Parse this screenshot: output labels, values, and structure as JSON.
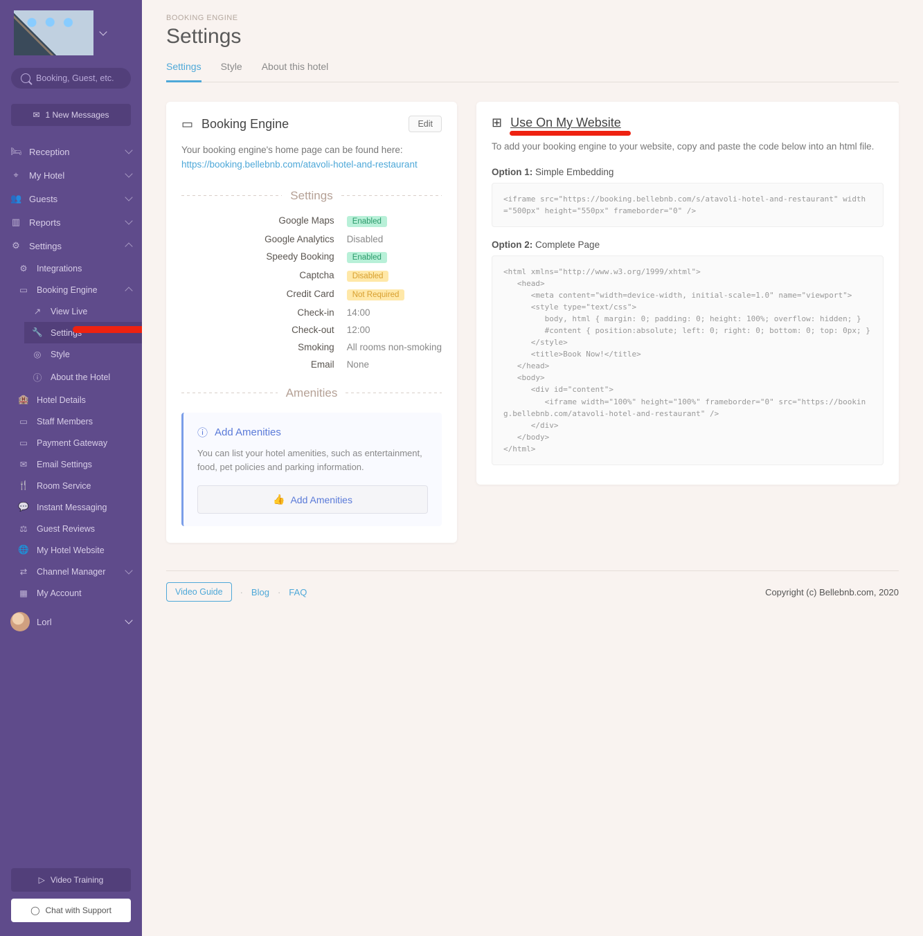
{
  "search": {
    "placeholder": "Booking, Guest, etc."
  },
  "messages_btn": "1 New Messages",
  "nav": {
    "reception": "Reception",
    "myhotel": "My Hotel",
    "guests": "Guests",
    "reports": "Reports",
    "settings": "Settings",
    "integrations": "Integrations",
    "booking_engine": "Booking Engine",
    "view_live": "View Live",
    "be_settings": "Settings",
    "be_style": "Style",
    "about_hotel": "About the Hotel",
    "hotel_details": "Hotel Details",
    "staff": "Staff Members",
    "payment": "Payment Gateway",
    "email": "Email Settings",
    "room_service": "Room Service",
    "im": "Instant Messaging",
    "reviews": "Guest Reviews",
    "website": "My Hotel Website",
    "channel": "Channel Manager",
    "account": "My Account"
  },
  "user": "Lorl",
  "video_training": "Video Training",
  "chat_support": "Chat with Support",
  "crumb": "BOOKING ENGINE",
  "page_title": "Settings",
  "tabs": {
    "settings": "Settings",
    "style": "Style",
    "about": "About this hotel"
  },
  "left": {
    "title": "Booking Engine",
    "edit": "Edit",
    "desc": "Your booking engine's home page can be found here:",
    "url": "https://booking.bellebnb.com/atavoli-hotel-and-restaurant",
    "settings_hd": "Settings",
    "rows": {
      "gmaps_k": "Google Maps",
      "gmaps_v": "Enabled",
      "ga_k": "Google Analytics",
      "ga_v": "Disabled",
      "speedy_k": "Speedy Booking",
      "speedy_v": "Enabled",
      "captcha_k": "Captcha",
      "captcha_v": "Disabled",
      "cc_k": "Credit Card",
      "cc_v": "Not Required",
      "ci_k": "Check-in",
      "ci_v": "14:00",
      "co_k": "Check-out",
      "co_v": "12:00",
      "smoke_k": "Smoking",
      "smoke_v": "All rooms non-smoking",
      "email_k": "Email",
      "email_v": "None"
    },
    "amenities_hd": "Amenities",
    "add_am_title": "Add Amenities",
    "add_am_desc": "You can list your hotel amenities, such as entertainment, food, pet policies and parking information.",
    "add_am_btn": "Add Amenities"
  },
  "right": {
    "title": "Use On My Website",
    "desc": "To add your booking engine to your website, copy and paste the code below into an html file.",
    "opt1_label": "Option 1:",
    "opt1_text": "Simple Embedding",
    "code1": "<iframe src=\"https://booking.bellebnb.com/s/atavoli-hotel-and-restaurant\" width=\"500px\" height=\"550px\" frameborder=\"0\" />",
    "opt2_label": "Option 2:",
    "opt2_text": "Complete Page",
    "code2": "<html xmlns=\"http://www.w3.org/1999/xhtml\">\n   <head>\n      <meta content=\"width=device-width, initial-scale=1.0\" name=\"viewport\">\n      <style type=\"text/css\">\n         body, html { margin: 0; padding: 0; height: 100%; overflow: hidden; }\n         #content { position:absolute; left: 0; right: 0; bottom: 0; top: 0px; }\n      </style>\n      <title>Book Now!</title>\n   </head>\n   <body>\n      <div id=\"content\">\n         <iframe width=\"100%\" height=\"100%\" frameborder=\"0\" src=\"https://booking.bellebnb.com/atavoli-hotel-and-restaurant\" />\n      </div>\n   </body>\n</html>"
  },
  "footer": {
    "video_guide": "Video Guide",
    "blog": "Blog",
    "faq": "FAQ",
    "copyright": "Copyright (c) Bellebnb.com, 2020"
  }
}
